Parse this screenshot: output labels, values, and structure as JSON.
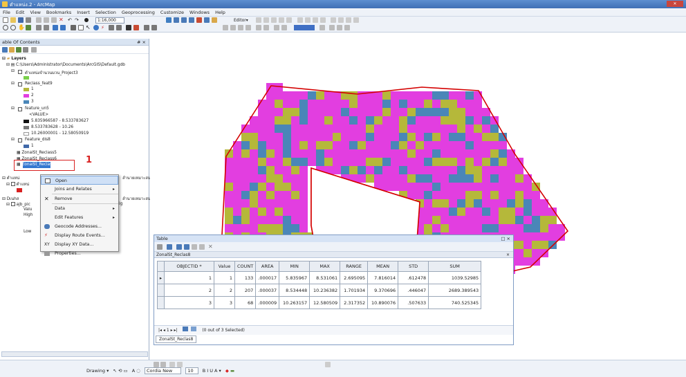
{
  "window": {
    "title": "ตำแหน่ง.2 - ArcMap"
  },
  "menu": [
    "File",
    "Edit",
    "View",
    "Bookmarks",
    "Insert",
    "Selection",
    "Geoprocessing",
    "Customize",
    "Windows",
    "Help"
  ],
  "toolbar": {
    "scale": "1:16,000",
    "editor_label": "Editor▾"
  },
  "toc": {
    "title": "able Of Contents",
    "close": "# ×",
    "layers_label": "Layers",
    "gdb_path": "C:\\Users\\Administrator\\Documents\\ArcGIS\\Default.gdb",
    "layer_project": "ตำแหน่งจำนวนมวน_Project3",
    "layer_reclass": "Reclass_feat9",
    "reclass_classes": [
      "1",
      "2",
      "3"
    ],
    "layer_feature": "feature_un5",
    "value_header": "<VALUE>",
    "feature_classes": [
      "5.835966587 - 8.533783627",
      "8.533783628 - 10.26",
      "10.26000001 - 12.58050919"
    ],
    "layer_featuredis": "Feature_dis8",
    "featuredis_class": "1",
    "zonal1": "ZonalSt_Reclass5",
    "zonal2": "ZonalSt_Reclass6",
    "zonal_selected": "ZonalSt_Reclass8",
    "annotation_number": "1",
    "partial_a": "ตำแหน่",
    "partial_b": "ตำแหน่",
    "partial_c": "Dเนhส",
    "partial_d": "ajb_pic",
    "partial_e": "Valu",
    "partial_f": "High",
    "partial_g": "Low",
    "right_text_1": "ลำนายเหมาะสม Ar",
    "right_text_2": "ลำนายเหมาะสม Ar",
    "right_text_3": "ig"
  },
  "context_menu": {
    "items": [
      {
        "label": "Open",
        "submenu": false
      },
      {
        "label": "Joins and Relates",
        "submenu": true
      },
      {
        "label": "Remove",
        "submenu": false
      },
      {
        "label": "Data",
        "submenu": true
      },
      {
        "label": "Edit Features",
        "submenu": true
      },
      {
        "label": "Geocode Addresses...",
        "submenu": false
      },
      {
        "label": "Display Route Events...",
        "submenu": false
      },
      {
        "label": "Display XY Data...",
        "submenu": false
      },
      {
        "label": "Properties...",
        "submenu": false
      }
    ]
  },
  "table_window": {
    "title": "Table",
    "controls": "□ ×",
    "tab_name": "ZonalSt_Reclas8",
    "columns": [
      "OBJECTID *",
      "Value",
      "COUNT",
      "AREA",
      "MIN",
      "MAX",
      "RANGE",
      "MEAN",
      "STD",
      "SUM"
    ],
    "rows": [
      [
        "1",
        "1",
        "133",
        ".000017",
        "5.835967",
        "8.531061",
        "2.695095",
        "7.816014",
        ".612478",
        "1039.52985"
      ],
      [
        "2",
        "2",
        "207",
        ".000037",
        "8.534448",
        "10.236382",
        "1.701934",
        "9.370696",
        ".446047",
        "2689.389543"
      ],
      [
        "3",
        "3",
        "68",
        ".000009",
        "10.263157",
        "12.580509",
        "2.317352",
        "10.890076",
        ".507633",
        "740.525345"
      ]
    ],
    "record_nav": "|◂  ◂      1   ▸  ▸|",
    "selection_status": "(0 out of 3 Selected)",
    "bottom_tab": "ZonalSt_Reclas8"
  },
  "statusbar": {
    "drawing": "Drawing ▾",
    "font": "Cordia New",
    "size": "10",
    "format": "B  I  U  A ▾"
  },
  "colors": {
    "magenta": "#e23ee0",
    "olive": "#b5b83a",
    "blue": "#4a86b8",
    "boundary": "#d40000"
  }
}
